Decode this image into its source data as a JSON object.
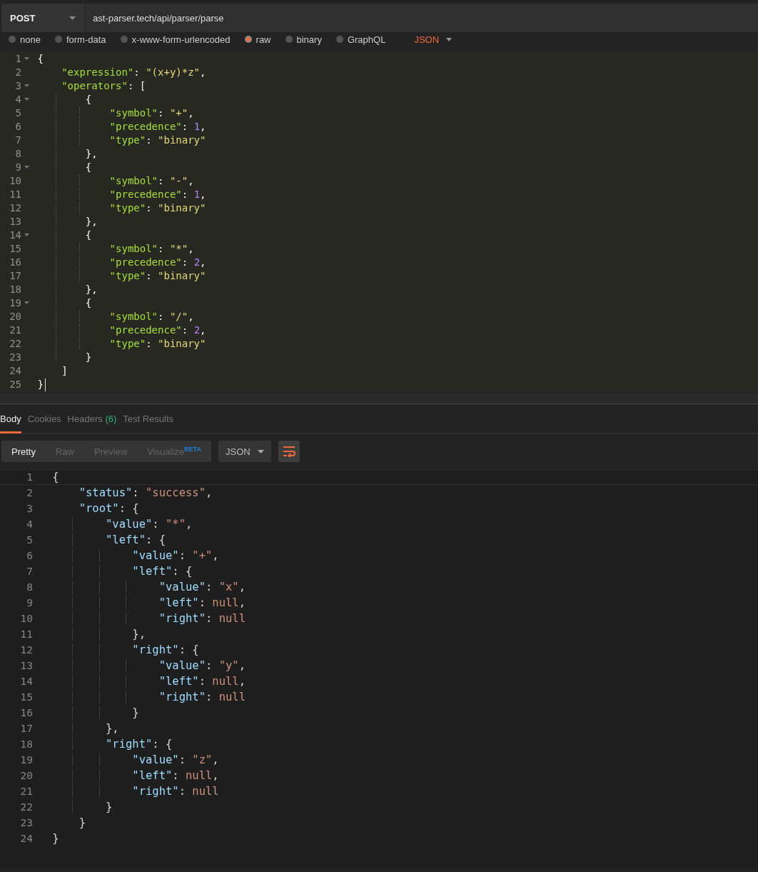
{
  "request": {
    "method": "POST",
    "url": "ast-parser.tech/api/parser/parse"
  },
  "body_types": [
    {
      "label": "none",
      "selected": false
    },
    {
      "label": "form-data",
      "selected": false
    },
    {
      "label": "x-www-form-urlencoded",
      "selected": false
    },
    {
      "label": "raw",
      "selected": true
    },
    {
      "label": "binary",
      "selected": false
    },
    {
      "label": "GraphQL",
      "selected": false
    }
  ],
  "raw_format": "JSON",
  "request_editor": {
    "lines": [
      {
        "number": "1",
        "text": "{",
        "fold": true
      },
      {
        "number": "2",
        "text": "    \"expression\": \"(x+y)*z\",",
        "fold": false
      },
      {
        "number": "3",
        "text": "    \"operators\": [",
        "fold": true
      },
      {
        "number": "4",
        "text": "        {",
        "fold": true
      },
      {
        "number": "5",
        "text": "            \"symbol\": \"+\",",
        "fold": false
      },
      {
        "number": "6",
        "text": "            \"precedence\": 1,",
        "fold": false
      },
      {
        "number": "7",
        "text": "            \"type\": \"binary\"",
        "fold": false
      },
      {
        "number": "8",
        "text": "        },",
        "fold": false
      },
      {
        "number": "9",
        "text": "        {",
        "fold": true
      },
      {
        "number": "10",
        "text": "            \"symbol\": \"-\",",
        "fold": false
      },
      {
        "number": "11",
        "text": "            \"precedence\": 1,",
        "fold": false
      },
      {
        "number": "12",
        "text": "            \"type\": \"binary\"",
        "fold": false
      },
      {
        "number": "13",
        "text": "        },",
        "fold": false
      },
      {
        "number": "14",
        "text": "        {",
        "fold": true
      },
      {
        "number": "15",
        "text": "            \"symbol\": \"*\",",
        "fold": false
      },
      {
        "number": "16",
        "text": "            \"precedence\": 2,",
        "fold": false
      },
      {
        "number": "17",
        "text": "            \"type\": \"binary\"",
        "fold": false
      },
      {
        "number": "18",
        "text": "        },",
        "fold": false
      },
      {
        "number": "19",
        "text": "        {",
        "fold": true
      },
      {
        "number": "20",
        "text": "            \"symbol\": \"/\",",
        "fold": false
      },
      {
        "number": "21",
        "text": "            \"precedence\": 2,",
        "fold": false
      },
      {
        "number": "22",
        "text": "            \"type\": \"binary\"",
        "fold": false
      },
      {
        "number": "23",
        "text": "        }",
        "fold": false
      },
      {
        "number": "24",
        "text": "    ]",
        "fold": false
      },
      {
        "number": "25",
        "text": "}",
        "fold": false
      }
    ]
  },
  "response_tabs": [
    {
      "label": "Body",
      "selected": true
    },
    {
      "label": "Cookies",
      "selected": false
    },
    {
      "label": "Headers",
      "count": "(6)",
      "selected": false
    },
    {
      "label": "Test Results",
      "selected": false
    }
  ],
  "view_modes": [
    {
      "label": "Pretty",
      "selected": true
    },
    {
      "label": "Raw",
      "selected": false
    },
    {
      "label": "Preview",
      "selected": false
    },
    {
      "label": "Visualize",
      "badge": "BETA",
      "selected": false
    }
  ],
  "response_format": "JSON",
  "response_editor": {
    "lines": [
      {
        "number": "1",
        "text": "{"
      },
      {
        "number": "2",
        "text": "    \"status\": \"success\","
      },
      {
        "number": "3",
        "text": "    \"root\": {"
      },
      {
        "number": "4",
        "text": "        \"value\": \"*\","
      },
      {
        "number": "5",
        "text": "        \"left\": {"
      },
      {
        "number": "6",
        "text": "            \"value\": \"+\","
      },
      {
        "number": "7",
        "text": "            \"left\": {"
      },
      {
        "number": "8",
        "text": "                \"value\": \"x\","
      },
      {
        "number": "9",
        "text": "                \"left\": null,"
      },
      {
        "number": "10",
        "text": "                \"right\": null"
      },
      {
        "number": "11",
        "text": "            },"
      },
      {
        "number": "12",
        "text": "            \"right\": {"
      },
      {
        "number": "13",
        "text": "                \"value\": \"y\","
      },
      {
        "number": "14",
        "text": "                \"left\": null,"
      },
      {
        "number": "15",
        "text": "                \"right\": null"
      },
      {
        "number": "16",
        "text": "            }"
      },
      {
        "number": "17",
        "text": "        },"
      },
      {
        "number": "18",
        "text": "        \"right\": {"
      },
      {
        "number": "19",
        "text": "            \"value\": \"z\","
      },
      {
        "number": "20",
        "text": "            \"left\": null,"
      },
      {
        "number": "21",
        "text": "            \"right\": null"
      },
      {
        "number": "22",
        "text": "        }"
      },
      {
        "number": "23",
        "text": "    }"
      },
      {
        "number": "24",
        "text": "}"
      }
    ]
  }
}
